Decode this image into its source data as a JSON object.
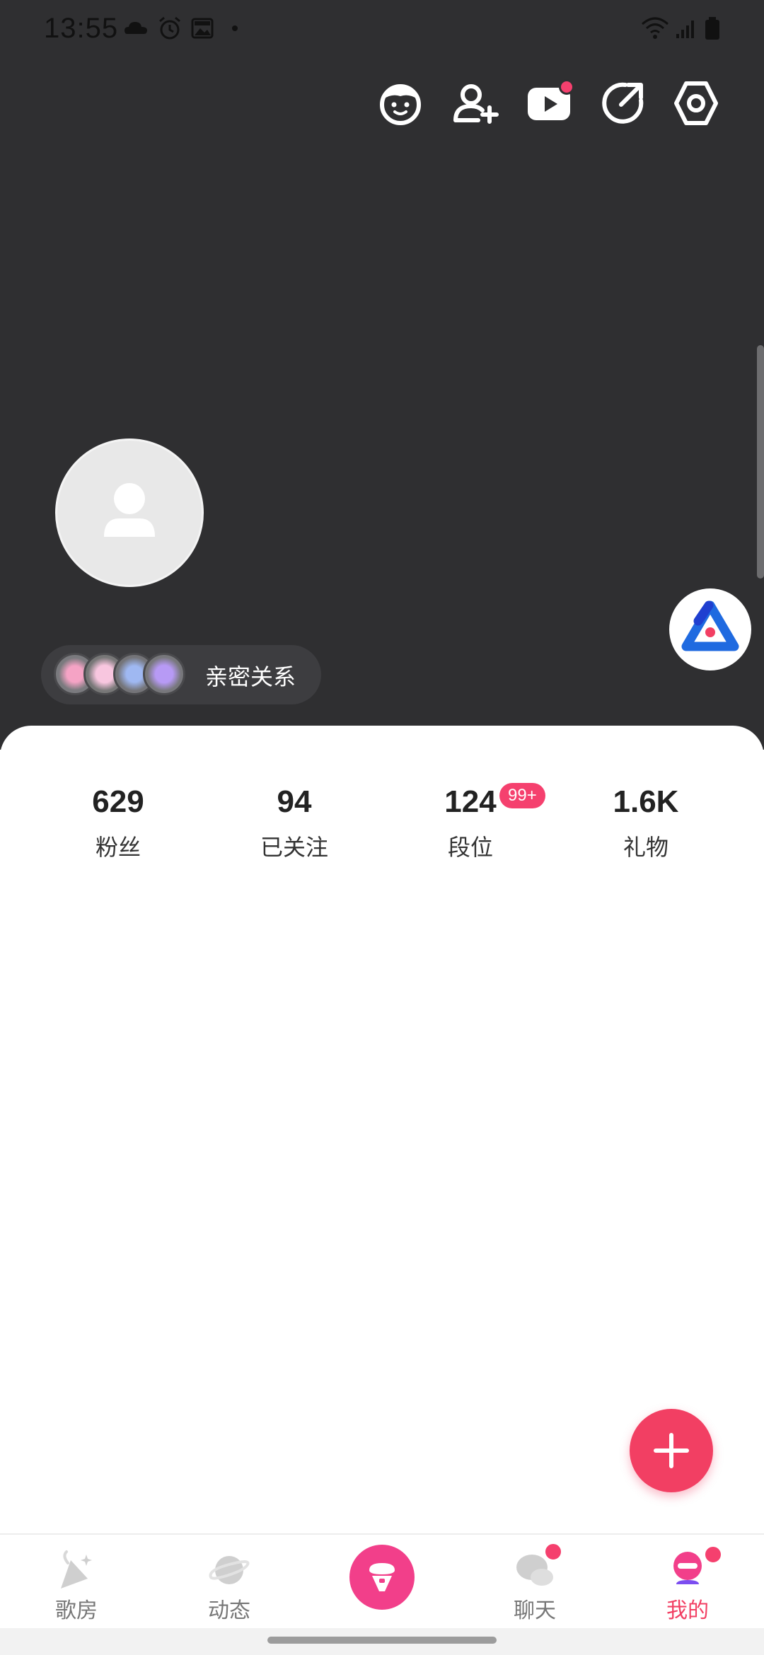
{
  "status_bar": {
    "time": "13:55"
  },
  "profile": {
    "intimate_label": "亲密关系"
  },
  "stats": [
    {
      "value": "629",
      "label": "粉丝"
    },
    {
      "value": "94",
      "label": "已关注"
    },
    {
      "value": "124",
      "label": "段位",
      "badge": "99+"
    },
    {
      "value": "1.6K",
      "label": "礼物"
    }
  ],
  "nav": {
    "items": [
      {
        "label": "歌房",
        "icon": "party-popper-icon"
      },
      {
        "label": "动态",
        "icon": "planet-icon"
      },
      {
        "label": "",
        "icon": "microphone-icon"
      },
      {
        "label": "聊天",
        "icon": "chat-bubbles-icon"
      },
      {
        "label": "我的",
        "icon": "profile-icon"
      }
    ],
    "active_index": 4
  },
  "colors": {
    "header_bg": "#2f2f31",
    "accent": "#f23f63",
    "badge": "#f5406e",
    "pink_nav": "#f23f8a",
    "badge_blue": "#1f6ae0"
  }
}
